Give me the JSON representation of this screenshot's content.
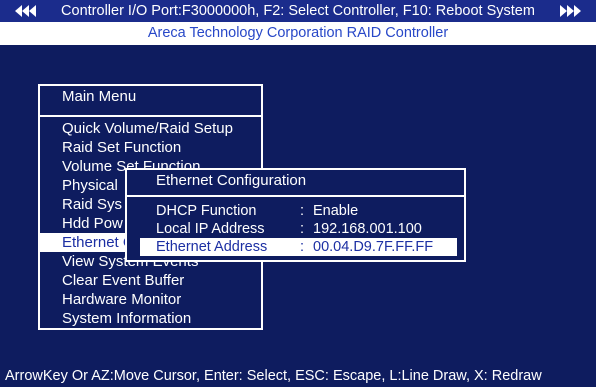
{
  "colors": {
    "background": "#0e1c5f",
    "text": "#ffffff",
    "highlight_bg": "#ffffff",
    "highlight_text": "#1c2fa3",
    "header_band": "#1b2c8c",
    "header_subtitle_text": "#2848c8"
  },
  "header": {
    "left_icon": "triple-left-arrow-icon",
    "status_line": "Controller I/O Port:F3000000h, F2: Select Controller, F10: Reboot System",
    "right_icon": "triple-right-arrow-icon",
    "subtitle": "Areca Technology Corporation RAID Controller"
  },
  "main_menu": {
    "title": "Main Menu",
    "items": [
      {
        "label": "Quick Volume/Raid Setup",
        "selected": false
      },
      {
        "label": "Raid Set Function",
        "selected": false
      },
      {
        "label": "Volume Set Function",
        "selected": false
      },
      {
        "label": "Physical",
        "selected": false
      },
      {
        "label": "Raid Sys",
        "selected": false
      },
      {
        "label": "Hdd Pow",
        "selected": false
      },
      {
        "label": "Ethernet C",
        "selected": true
      },
      {
        "label": "View System Events",
        "selected": false
      },
      {
        "label": "Clear Event Buffer",
        "selected": false
      },
      {
        "label": "Hardware Monitor",
        "selected": false
      },
      {
        "label": "System Information",
        "selected": false
      }
    ]
  },
  "ethernet_dialog": {
    "title": "Ethernet Configuration",
    "rows": [
      {
        "label": "DHCP Function",
        "separator": ":",
        "value": "Enable",
        "selected": false
      },
      {
        "label": "Local IP Address",
        "separator": ":",
        "value": "192.168.001.100",
        "selected": false
      },
      {
        "label": "Ethernet Address",
        "separator": ":",
        "value": "00.04.D9.7F.FF.FF",
        "selected": true
      }
    ]
  },
  "footer": {
    "help": "ArrowKey Or AZ:Move Cursor, Enter: Select, ESC: Escape, L:Line Draw, X: Redraw"
  }
}
